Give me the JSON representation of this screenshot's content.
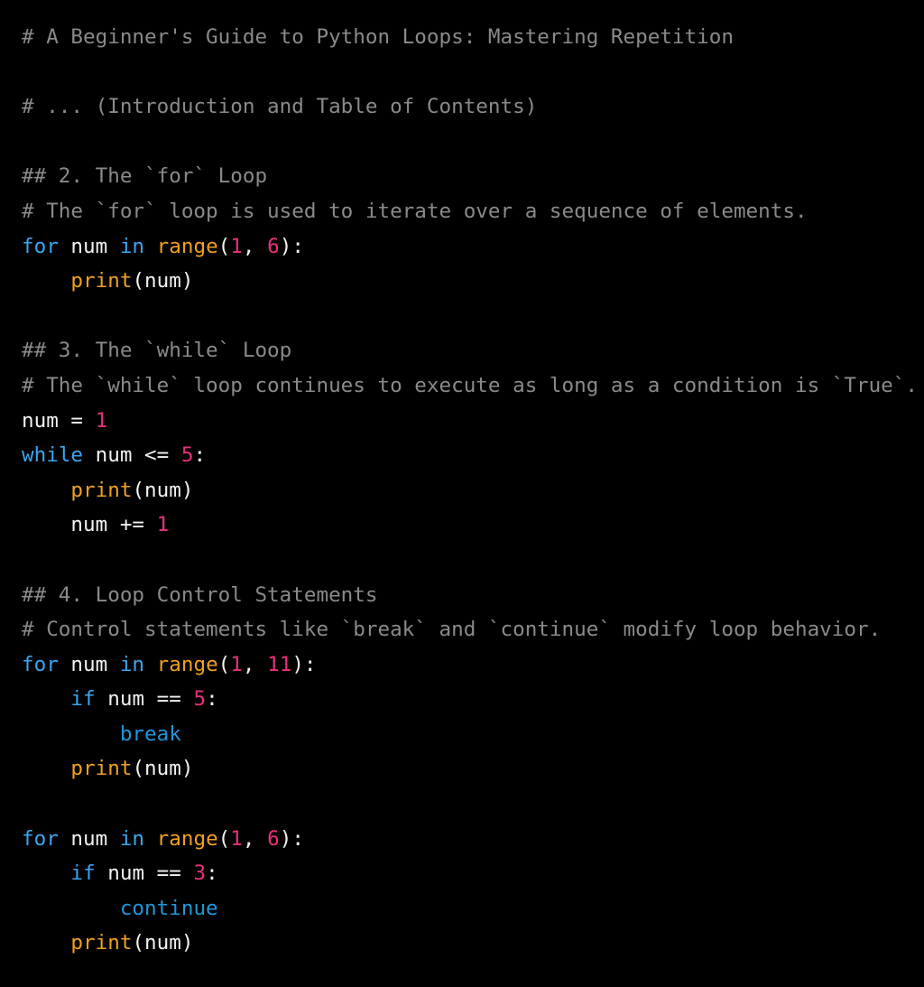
{
  "editor": {
    "background_color": "#000000",
    "name": "python-code-listing",
    "language": "python",
    "colors": {
      "comment": "#8a8a8a",
      "keyword": "#3aa5f0",
      "keyword_alt": "#2196d8",
      "builtin_function": "#f0a020",
      "number": "#e8307a",
      "plain_text": "#f2f2f2"
    }
  },
  "lines": [
    {
      "id": "line-1-title-comment",
      "type": "comment",
      "text": "# A Beginner's Guide to Python Loops: Mastering Repetition"
    },
    {
      "id": "line-2-blank",
      "type": "blank",
      "text": ""
    },
    {
      "id": "line-3-toc-comment",
      "type": "comment",
      "text": "# ... (Introduction and Table of Contents)"
    },
    {
      "id": "line-4-blank",
      "type": "blank",
      "text": ""
    },
    {
      "id": "line-5-heading-for-loop",
      "type": "comment",
      "text": "## 2. The `for` Loop"
    },
    {
      "id": "line-6-comment-for-loop",
      "type": "comment",
      "text": "# The `for` loop is used to iterate over a sequence of elements."
    },
    {
      "id": "line-7-for-statement",
      "type": "code",
      "tokens": [
        {
          "t": "for",
          "k": "keyword"
        },
        {
          "t": " num ",
          "k": "plain"
        },
        {
          "t": "in",
          "k": "keyword"
        },
        {
          "t": " ",
          "k": "plain"
        },
        {
          "t": "range",
          "k": "builtin"
        },
        {
          "t": "(",
          "k": "punct"
        },
        {
          "t": "1",
          "k": "number"
        },
        {
          "t": ", ",
          "k": "punct"
        },
        {
          "t": "6",
          "k": "number"
        },
        {
          "t": "):",
          "k": "punct"
        }
      ]
    },
    {
      "id": "line-8-print-num",
      "type": "code",
      "tokens": [
        {
          "t": "    ",
          "k": "plain"
        },
        {
          "t": "print",
          "k": "builtin"
        },
        {
          "t": "(num)",
          "k": "punct"
        }
      ]
    },
    {
      "id": "line-9-blank",
      "type": "blank",
      "text": ""
    },
    {
      "id": "line-10-heading-while-loop",
      "type": "comment",
      "text": "## 3. The `while` Loop"
    },
    {
      "id": "line-11-comment-while-loop",
      "type": "comment",
      "text": "# The `while` loop continues to execute as long as a condition is `True`."
    },
    {
      "id": "line-12-num-assign",
      "type": "code",
      "tokens": [
        {
          "t": "num = ",
          "k": "plain"
        },
        {
          "t": "1",
          "k": "number"
        }
      ]
    },
    {
      "id": "line-13-while-statement",
      "type": "code",
      "tokens": [
        {
          "t": "while",
          "k": "keyword"
        },
        {
          "t": " num <= ",
          "k": "plain"
        },
        {
          "t": "5",
          "k": "number"
        },
        {
          "t": ":",
          "k": "punct"
        }
      ]
    },
    {
      "id": "line-14-print-num",
      "type": "code",
      "tokens": [
        {
          "t": "    ",
          "k": "plain"
        },
        {
          "t": "print",
          "k": "builtin"
        },
        {
          "t": "(num)",
          "k": "punct"
        }
      ]
    },
    {
      "id": "line-15-num-increment",
      "type": "code",
      "tokens": [
        {
          "t": "    num += ",
          "k": "plain"
        },
        {
          "t": "1",
          "k": "number"
        }
      ]
    },
    {
      "id": "line-16-blank",
      "type": "blank",
      "text": ""
    },
    {
      "id": "line-17-heading-loop-control",
      "type": "comment",
      "text": "## 4. Loop Control Statements"
    },
    {
      "id": "line-18-comment-loop-control",
      "type": "comment",
      "text": "# Control statements like `break` and `continue` modify loop behavior."
    },
    {
      "id": "line-19-for-statement",
      "type": "code",
      "tokens": [
        {
          "t": "for",
          "k": "keyword"
        },
        {
          "t": " num ",
          "k": "plain"
        },
        {
          "t": "in",
          "k": "keyword"
        },
        {
          "t": " ",
          "k": "plain"
        },
        {
          "t": "range",
          "k": "builtin"
        },
        {
          "t": "(",
          "k": "punct"
        },
        {
          "t": "1",
          "k": "number"
        },
        {
          "t": ", ",
          "k": "punct"
        },
        {
          "t": "11",
          "k": "number"
        },
        {
          "t": "):",
          "k": "punct"
        }
      ]
    },
    {
      "id": "line-20-if-statement",
      "type": "code",
      "tokens": [
        {
          "t": "    ",
          "k": "plain"
        },
        {
          "t": "if",
          "k": "keyword"
        },
        {
          "t": " num == ",
          "k": "plain"
        },
        {
          "t": "5",
          "k": "number"
        },
        {
          "t": ":",
          "k": "punct"
        }
      ]
    },
    {
      "id": "line-21-break-statement",
      "type": "code",
      "tokens": [
        {
          "t": "        ",
          "k": "plain"
        },
        {
          "t": "break",
          "k": "keyword_alt"
        }
      ]
    },
    {
      "id": "line-22-print-num",
      "type": "code",
      "tokens": [
        {
          "t": "    ",
          "k": "plain"
        },
        {
          "t": "print",
          "k": "builtin"
        },
        {
          "t": "(num)",
          "k": "punct"
        }
      ]
    },
    {
      "id": "line-23-blank",
      "type": "blank",
      "text": ""
    },
    {
      "id": "line-24-for-statement",
      "type": "code",
      "tokens": [
        {
          "t": "for",
          "k": "keyword"
        },
        {
          "t": " num ",
          "k": "plain"
        },
        {
          "t": "in",
          "k": "keyword"
        },
        {
          "t": " ",
          "k": "plain"
        },
        {
          "t": "range",
          "k": "builtin"
        },
        {
          "t": "(",
          "k": "punct"
        },
        {
          "t": "1",
          "k": "number"
        },
        {
          "t": ", ",
          "k": "punct"
        },
        {
          "t": "6",
          "k": "number"
        },
        {
          "t": "):",
          "k": "punct"
        }
      ]
    },
    {
      "id": "line-25-if-statement",
      "type": "code",
      "tokens": [
        {
          "t": "    ",
          "k": "plain"
        },
        {
          "t": "if",
          "k": "keyword"
        },
        {
          "t": " num == ",
          "k": "plain"
        },
        {
          "t": "3",
          "k": "number"
        },
        {
          "t": ":",
          "k": "punct"
        }
      ]
    },
    {
      "id": "line-26-continue-statement",
      "type": "code",
      "tokens": [
        {
          "t": "        ",
          "k": "plain"
        },
        {
          "t": "continue",
          "k": "keyword_alt"
        }
      ]
    },
    {
      "id": "line-27-print-num",
      "type": "code",
      "tokens": [
        {
          "t": "    ",
          "k": "plain"
        },
        {
          "t": "print",
          "k": "builtin"
        },
        {
          "t": "(num)",
          "k": "punct"
        }
      ]
    }
  ]
}
